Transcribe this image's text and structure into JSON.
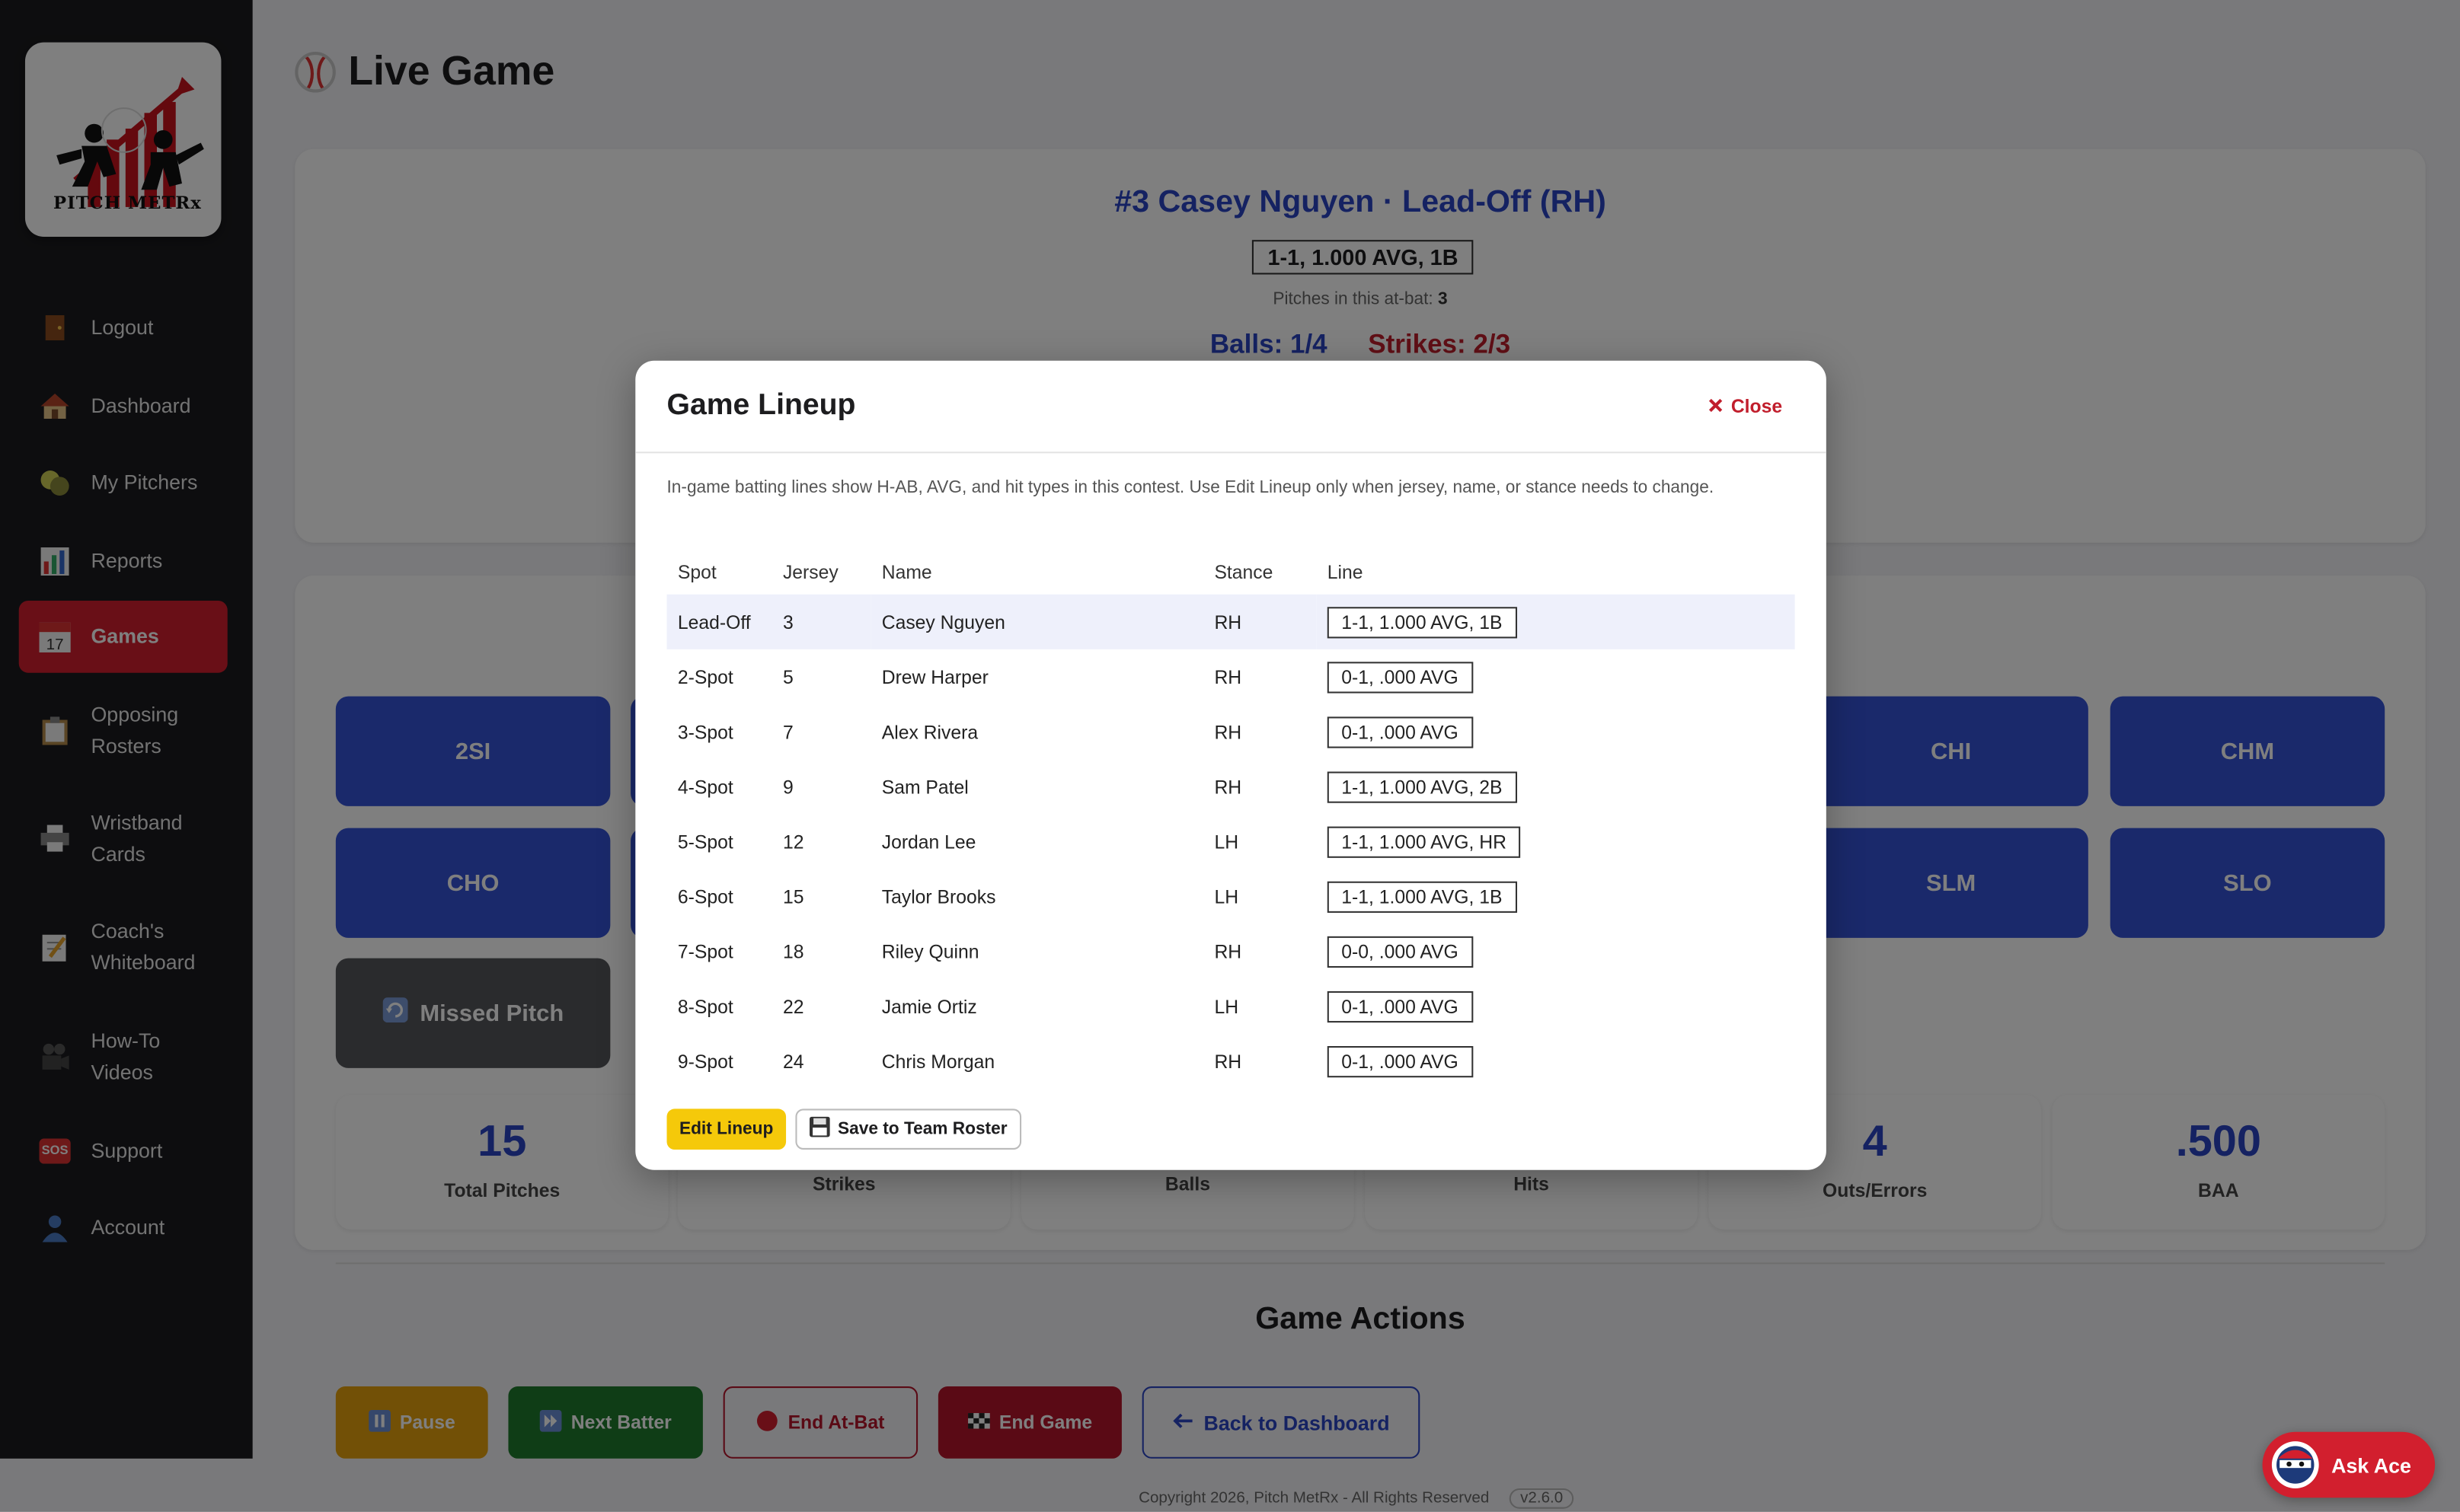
{
  "app": {
    "logo_text": "PITCH METRx"
  },
  "sidebar": {
    "items": [
      {
        "label": "Logout",
        "icon": "door-icon"
      },
      {
        "label": "Dashboard",
        "icon": "house-icon"
      },
      {
        "label": "My Pitchers",
        "icon": "baseball-icon"
      },
      {
        "label": "Reports",
        "icon": "bar-chart-icon"
      },
      {
        "label": "Games",
        "icon": "calendar-icon",
        "active": true,
        "badge": "17"
      },
      {
        "label": "Opposing Rosters",
        "icon": "clipboard-icon"
      },
      {
        "label": "Wristband Cards",
        "icon": "printer-icon"
      },
      {
        "label": "Coach's Whiteboard",
        "icon": "memo-icon"
      },
      {
        "label": "How-To Videos",
        "icon": "video-camera-icon"
      },
      {
        "label": "Support",
        "icon": "sos-icon"
      },
      {
        "label": "Account",
        "icon": "user-icon"
      }
    ],
    "sos_badge": "SOS"
  },
  "page": {
    "title": "Live Game"
  },
  "batter": {
    "title": "#3 Casey Nguyen · Lead-Off (RH)",
    "line": "1-1, 1.000 AVG, 1B",
    "pitches_label": "Pitches in this at-bat: ",
    "pitches_value": "3",
    "balls": "Balls: 1/4",
    "strikes": "Strikes: 2/3"
  },
  "pitch_buttons": {
    "row1": [
      "2SI",
      "CHI",
      "CHM"
    ],
    "row2": [
      "CHO",
      "SLM",
      "SLO"
    ],
    "missed": "Missed Pitch"
  },
  "stats": [
    {
      "value": "15",
      "label": "Total Pitches"
    },
    {
      "value": "",
      "label": "Strikes"
    },
    {
      "value": "",
      "label": "Balls"
    },
    {
      "value": "",
      "label": "Hits"
    },
    {
      "value": "4",
      "label": "Outs/Errors"
    },
    {
      "value": ".500",
      "label": "BAA"
    }
  ],
  "actions": {
    "title": "Game Actions",
    "pause": "Pause",
    "next_batter": "Next Batter",
    "end_at_bat": "End At-Bat",
    "end_game": "End Game",
    "back": "Back to Dashboard"
  },
  "footer": {
    "text": "Copyright 2026, Pitch MetRx - All Rights Reserved",
    "version": "v2.6.0"
  },
  "ask_ace": "Ask Ace",
  "modal": {
    "title": "Game Lineup",
    "close": "Close",
    "description": "In-game batting lines show H-AB, AVG, and hit types in this contest. Use Edit Lineup only when jersey, name, or stance needs to change.",
    "columns": [
      "Spot",
      "Jersey",
      "Name",
      "Stance",
      "Line"
    ],
    "rows": [
      {
        "spot": "Lead-Off",
        "jersey": "3",
        "name": "Casey Nguyen",
        "stance": "RH",
        "line": "1-1, 1.000 AVG, 1B"
      },
      {
        "spot": "2-Spot",
        "jersey": "5",
        "name": "Drew Harper",
        "stance": "RH",
        "line": "0-1, .000 AVG"
      },
      {
        "spot": "3-Spot",
        "jersey": "7",
        "name": "Alex Rivera",
        "stance": "RH",
        "line": "0-1, .000 AVG"
      },
      {
        "spot": "4-Spot",
        "jersey": "9",
        "name": "Sam Patel",
        "stance": "RH",
        "line": "1-1, 1.000 AVG, 2B"
      },
      {
        "spot": "5-Spot",
        "jersey": "12",
        "name": "Jordan Lee",
        "stance": "LH",
        "line": "1-1, 1.000 AVG, HR"
      },
      {
        "spot": "6-Spot",
        "jersey": "15",
        "name": "Taylor Brooks",
        "stance": "LH",
        "line": "1-1, 1.000 AVG, 1B"
      },
      {
        "spot": "7-Spot",
        "jersey": "18",
        "name": "Riley Quinn",
        "stance": "RH",
        "line": "0-0, .000 AVG"
      },
      {
        "spot": "8-Spot",
        "jersey": "22",
        "name": "Jamie Ortiz",
        "stance": "LH",
        "line": "0-1, .000 AVG"
      },
      {
        "spot": "9-Spot",
        "jersey": "24",
        "name": "Chris Morgan",
        "stance": "RH",
        "line": "0-1, .000 AVG"
      }
    ],
    "edit_lineup": "Edit Lineup",
    "save_roster": "Save to Team Roster"
  },
  "colors": {
    "brand_red": "#d21f2e",
    "pitch_blue": "#3553d6",
    "stat_blue": "#2a45c4",
    "pause_orange": "#e5a00d",
    "next_green": "#1e7a2c",
    "end_game_red": "#b5142a",
    "edit_yellow": "#f5c90a"
  }
}
